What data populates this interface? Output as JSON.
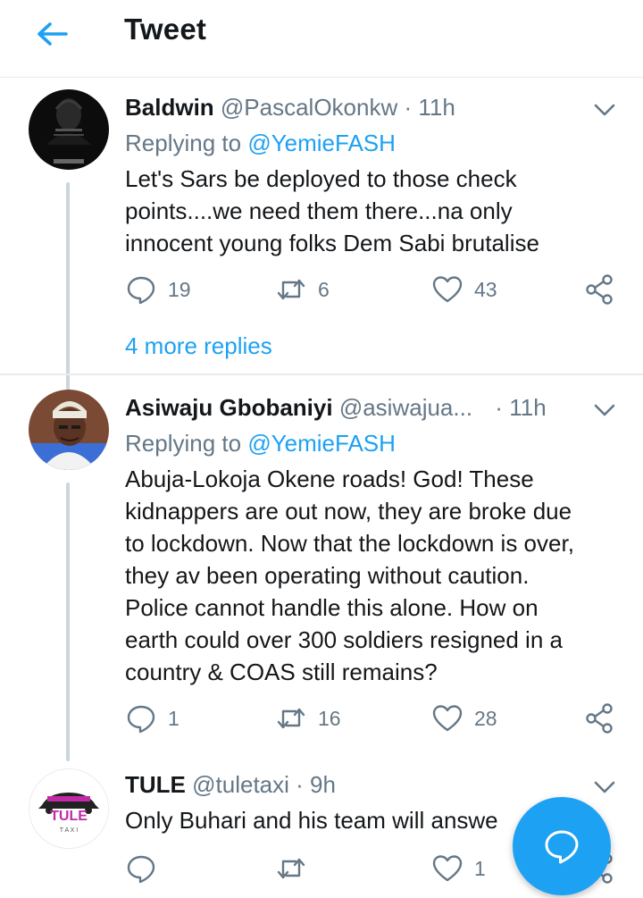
{
  "header": {
    "title": "Tweet"
  },
  "tweets": [
    {
      "name": "Baldwin",
      "handle": "@PascalOkonkw",
      "dot": "·",
      "time": "11h",
      "replying_prefix": "Replying to ",
      "replying_to": "@YemieFASH",
      "text": "Let's Sars be deployed to those check\npoints....we need them there...na only\ninnocent young folks Dem Sabi brutalise",
      "replies": "19",
      "retweets": "6",
      "likes": "43",
      "more_replies": "4 more replies"
    },
    {
      "name": "Asiwaju Gbobaniyi",
      "handle": "@asiwajua...",
      "dot": "·",
      "time": "11h",
      "replying_prefix": "Replying to ",
      "replying_to": "@YemieFASH",
      "text": "Abuja-Lokoja Okene roads! God! These\nkidnappers are out now, they are broke due\nto lockdown. Now that the lockdown is over,\nthey av been operating without caution.\nPolice cannot handle this alone. How on\nearth could over 300 soldiers resigned in a\ncountry & COAS still remains?",
      "replies": "1",
      "retweets": "16",
      "likes": "28"
    },
    {
      "name": "TULE",
      "handle": "@tuletaxi",
      "dot": "·",
      "time": "9h",
      "text": "Only Buhari and his team will answe",
      "replies": "",
      "retweets": "",
      "likes": "1",
      "avatar_logo": "TULE",
      "avatar_sub": "T A X I"
    }
  ],
  "icons": {
    "back": "arrow-left-icon",
    "caret": "chevron-down-icon",
    "reply": "speech-bubble-icon",
    "retweet": "retweet-icon",
    "like": "heart-icon",
    "share": "share-icon",
    "compose": "compose-reply-icon"
  },
  "colors": {
    "accent": "#1da1f2",
    "muted": "#657786",
    "text": "#14171a",
    "divider": "#e6ecf0"
  }
}
